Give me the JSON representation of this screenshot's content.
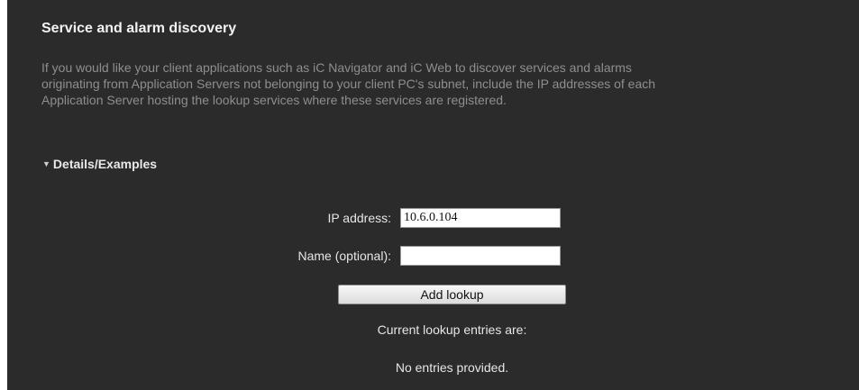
{
  "section": {
    "title": "Service and alarm discovery",
    "description_lines": [
      "If you would like your client applications such as iC Navigator and iC Web to discover services and alarms",
      "originating from Application Servers not belonging to your client PC's subnet, include the IP addresses of each",
      "Application Server hosting the lookup services where these services are registered."
    ],
    "details_toggle": "Details/Examples",
    "details_icon": "triangle-down-icon"
  },
  "form": {
    "ip_label": "IP address:",
    "ip_value": "10.6.0.104",
    "name_label": "Name (optional):",
    "name_value": "",
    "add_button_label": "Add lookup"
  },
  "entries": {
    "heading": "Current lookup entries are:",
    "empty_message": "No entries provided."
  },
  "colors": {
    "panel_background": "#2b2b2b",
    "description_text": "#8e8e8e",
    "page_background": "#ffffff"
  }
}
